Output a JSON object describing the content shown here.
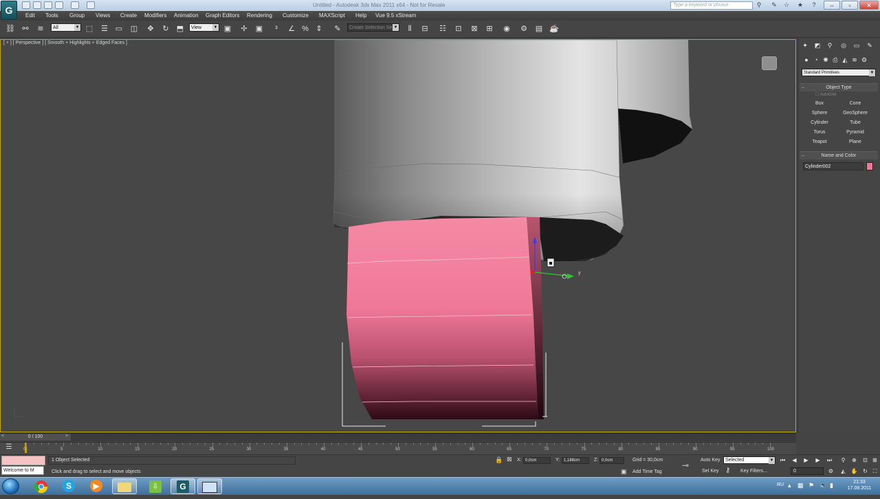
{
  "title_bar": {
    "logo": "G",
    "title": "Untitled - Autodesk 3ds Max 2011 x64 - Not for Resale",
    "search_placeholder": "Type a keyword or phrase",
    "controls": [
      "–",
      "▫",
      "✕"
    ]
  },
  "menu": [
    "Edit",
    "Tools",
    "Group",
    "Views",
    "Create",
    "Modifiers",
    "Animation",
    "Graph Editors",
    "Rendering",
    "Customize",
    "MAXScript",
    "Help",
    "Vue 9.5 xStream"
  ],
  "toolbar": {
    "selection_filter": "All",
    "ref_coord": "View",
    "named_selection": "Create Selection Se"
  },
  "viewport": {
    "label": "[ + ] [ Perspective ] [ Smooth + Highlights + Edged Faces ]",
    "gizmo_y_label": "y"
  },
  "command_panel": {
    "tabs": [
      "create-tab",
      "modify-tab",
      "hierarchy-tab",
      "motion-tab",
      "display-tab",
      "utilities-tab"
    ],
    "category_dropdown": "Standard Primitives",
    "object_type_header": "Object Type",
    "autogrid_label": "AutoGrid",
    "object_buttons": [
      [
        "Box",
        "Cone"
      ],
      [
        "Sphere",
        "GeoSphere"
      ],
      [
        "Cylinder",
        "Tube"
      ],
      [
        "Torus",
        "Pyramid"
      ],
      [
        "Teapot",
        "Plane"
      ]
    ],
    "name_color_header": "Name and Color",
    "object_name": "Cylinder002",
    "object_color": "#f07898"
  },
  "timeline": {
    "frame_display": "0 / 100",
    "ruler_labels": [
      "0",
      "5",
      "10",
      "15",
      "20",
      "25",
      "30",
      "35",
      "40",
      "45",
      "50",
      "55",
      "60",
      "65",
      "70",
      "75",
      "80",
      "85",
      "90",
      "95",
      "100"
    ]
  },
  "status": {
    "maxscript_listener": "Welcome to M",
    "selection_status": "1 Object Selected",
    "prompt": "Click and drag to select and move objects",
    "x_label": "X:",
    "x_value": "0,0cm",
    "y_label": "Y:",
    "y_value": "1,188cm",
    "z_label": "Z:",
    "z_value": "0,0cm",
    "grid": "Grid = 30,0cm",
    "add_time_tag": "Add Time Tag",
    "auto_key": "Auto Key",
    "auto_key_mode": "Selected",
    "set_key": "Set Key",
    "key_filters": "Key Filters...",
    "current_frame": "0"
  },
  "taskbar": {
    "time": "21:33",
    "date": "17.08.2011",
    "lang": "RU"
  },
  "colors": {
    "object_pink": "#f07898",
    "viewport_bg": "#474747",
    "active_border": "#b9a900"
  }
}
